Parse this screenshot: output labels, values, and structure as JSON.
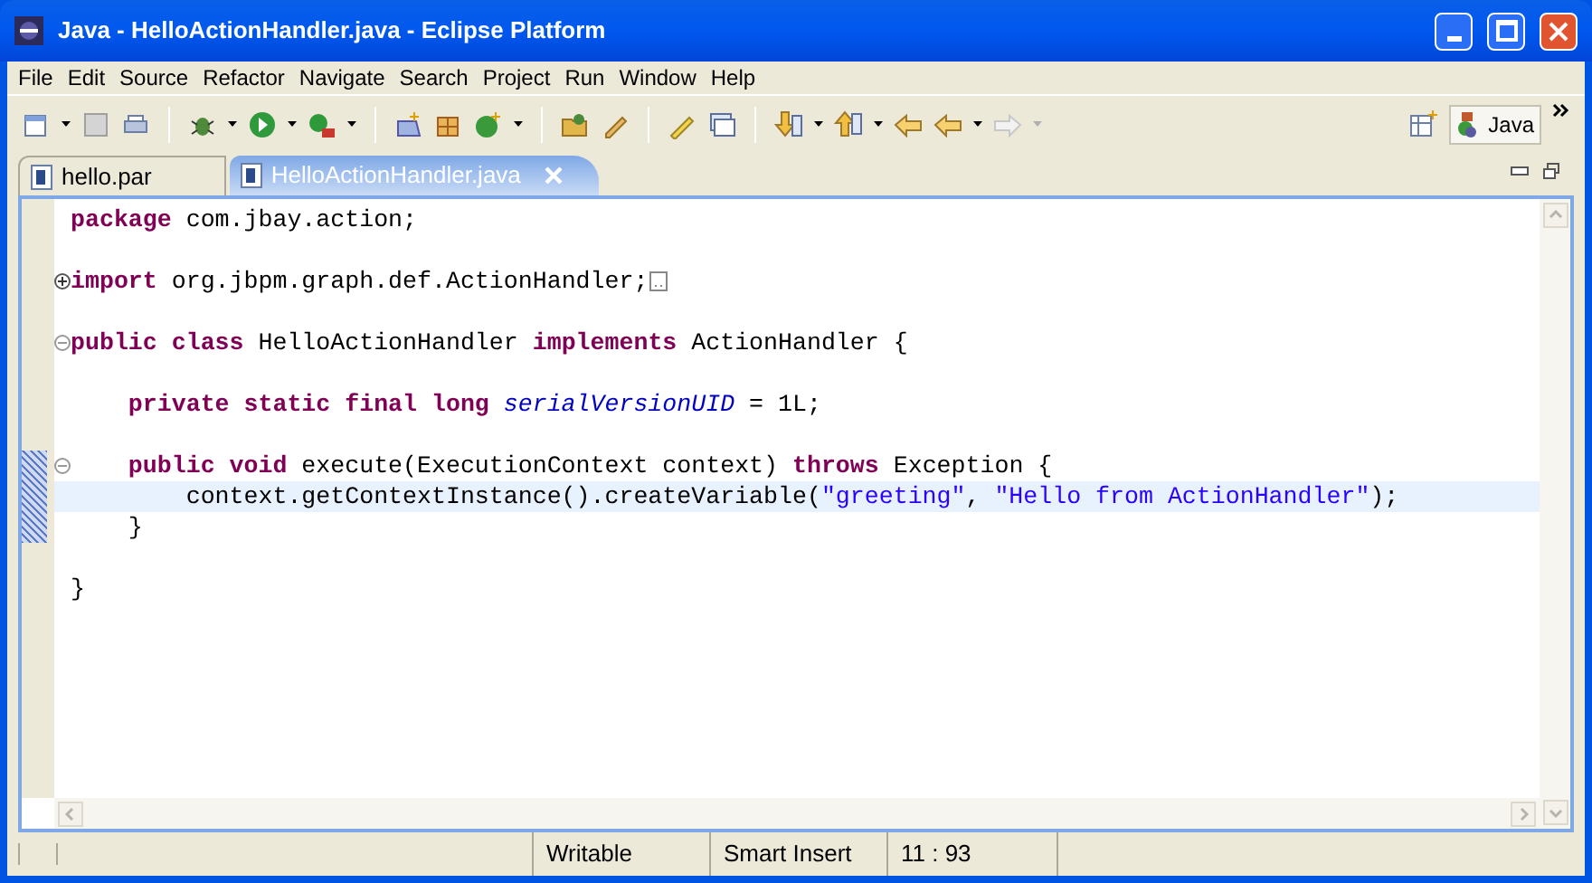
{
  "window": {
    "title": "Java - HelloActionHandler.java - Eclipse Platform"
  },
  "menu": [
    "File",
    "Edit",
    "Source",
    "Refactor",
    "Navigate",
    "Search",
    "Project",
    "Run",
    "Window",
    "Help"
  ],
  "perspective": {
    "label": "Java",
    "selected": true
  },
  "tabs": [
    {
      "label": "hello.par",
      "selected": false
    },
    {
      "label": "HelloActionHandler.java",
      "selected": true
    }
  ],
  "editor": {
    "lines": [
      {
        "kind": "code",
        "current": false,
        "annotated": false,
        "tokens": [
          {
            "kind": "keyword",
            "text": "package"
          },
          {
            "kind": "plain",
            "text": " com.jbay.action;"
          }
        ]
      },
      {
        "kind": "blank"
      },
      {
        "kind": "code",
        "current": false,
        "annotated": false,
        "folded": true,
        "tokens": [
          {
            "kind": "keyword",
            "text": "import"
          },
          {
            "kind": "plain",
            "text": " org.jbpm.graph.def.ActionHandler;"
          }
        ]
      },
      {
        "kind": "blank"
      },
      {
        "kind": "code",
        "current": false,
        "annotated": false,
        "folded": false,
        "tokens": [
          {
            "kind": "keyword",
            "text": "public class"
          },
          {
            "kind": "plain",
            "text": " HelloActionHandler "
          },
          {
            "kind": "keyword",
            "text": "implements"
          },
          {
            "kind": "plain",
            "text": " ActionHandler {"
          }
        ]
      },
      {
        "kind": "blank"
      },
      {
        "kind": "code",
        "current": false,
        "annotated": false,
        "tokens": [
          {
            "kind": "keyword",
            "text": "    private static final long"
          },
          {
            "kind": "field",
            "text": " serialVersionUID"
          },
          {
            "kind": "plain",
            "text": " = 1L;"
          }
        ]
      },
      {
        "kind": "blank"
      },
      {
        "kind": "code",
        "current": false,
        "annotated": true,
        "folded": false,
        "tokens": [
          {
            "kind": "keyword",
            "text": "    public void"
          },
          {
            "kind": "plain",
            "text": " execute(ExecutionContext context) "
          },
          {
            "kind": "keyword",
            "text": "throws"
          },
          {
            "kind": "plain",
            "text": " Exception {"
          }
        ]
      },
      {
        "kind": "code",
        "current": true,
        "annotated": true,
        "tokens": [
          {
            "kind": "plain",
            "text": "        context.getContextInstance().createVariable("
          },
          {
            "kind": "string",
            "text": "\"greeting\""
          },
          {
            "kind": "plain",
            "text": ", "
          },
          {
            "kind": "string",
            "text": "\"Hello from ActionHandler\""
          },
          {
            "kind": "plain",
            "text": ");"
          }
        ]
      },
      {
        "kind": "code",
        "current": false,
        "annotated": true,
        "tokens": [
          {
            "kind": "plain",
            "text": "    }"
          }
        ]
      },
      {
        "kind": "blank"
      },
      {
        "kind": "code",
        "current": false,
        "annotated": false,
        "tokens": [
          {
            "kind": "plain",
            "text": "}"
          }
        ]
      }
    ]
  },
  "status_bar": {
    "fields": [
      "Writable",
      "Smart Insert",
      "11 : 93"
    ]
  }
}
